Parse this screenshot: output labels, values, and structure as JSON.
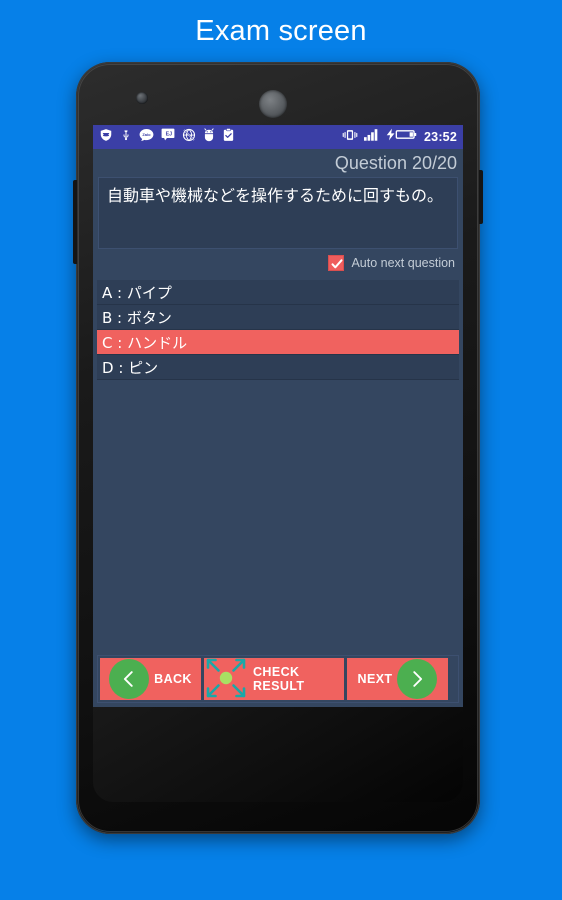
{
  "page": {
    "title": "Exam screen",
    "background_color": "#0680e8"
  },
  "colors": {
    "accent_red": "#f0625f",
    "accent_green": "#4caf50",
    "screen_bg": "#344660",
    "panel_bg": "#2e3e56",
    "statusbar_bg": "#3b3fa6",
    "muted_text": "#c3ccd6"
  },
  "statusbar": {
    "left_icons": [
      "shield-vpn-icon",
      "usb-icon",
      "zalo-chat-icon",
      "translate-message-icon",
      "data-saver-off-icon",
      "android-debug-icon",
      "clipboard-check-icon"
    ],
    "right_icons": [
      "vibrate-icon",
      "signal-bars-icon",
      "battery-charging-icon"
    ],
    "clock": "23:52"
  },
  "exam": {
    "progress_label": "Question 20/20",
    "question_text": "自動車や機械などを操作するために回すもの。",
    "auto_next": {
      "label": "Auto next question",
      "checked": true
    },
    "options": [
      {
        "key": "A",
        "text": "A : パイプ",
        "selected": false
      },
      {
        "key": "B",
        "text": "B : ボタン",
        "selected": false
      },
      {
        "key": "C",
        "text": "C : ハンドル",
        "selected": true
      },
      {
        "key": "D",
        "text": "D : ピン",
        "selected": false
      }
    ]
  },
  "bottom_bar": {
    "back_label": "BACK",
    "check_label": "CHECK RESULT",
    "next_label": "NEXT"
  }
}
